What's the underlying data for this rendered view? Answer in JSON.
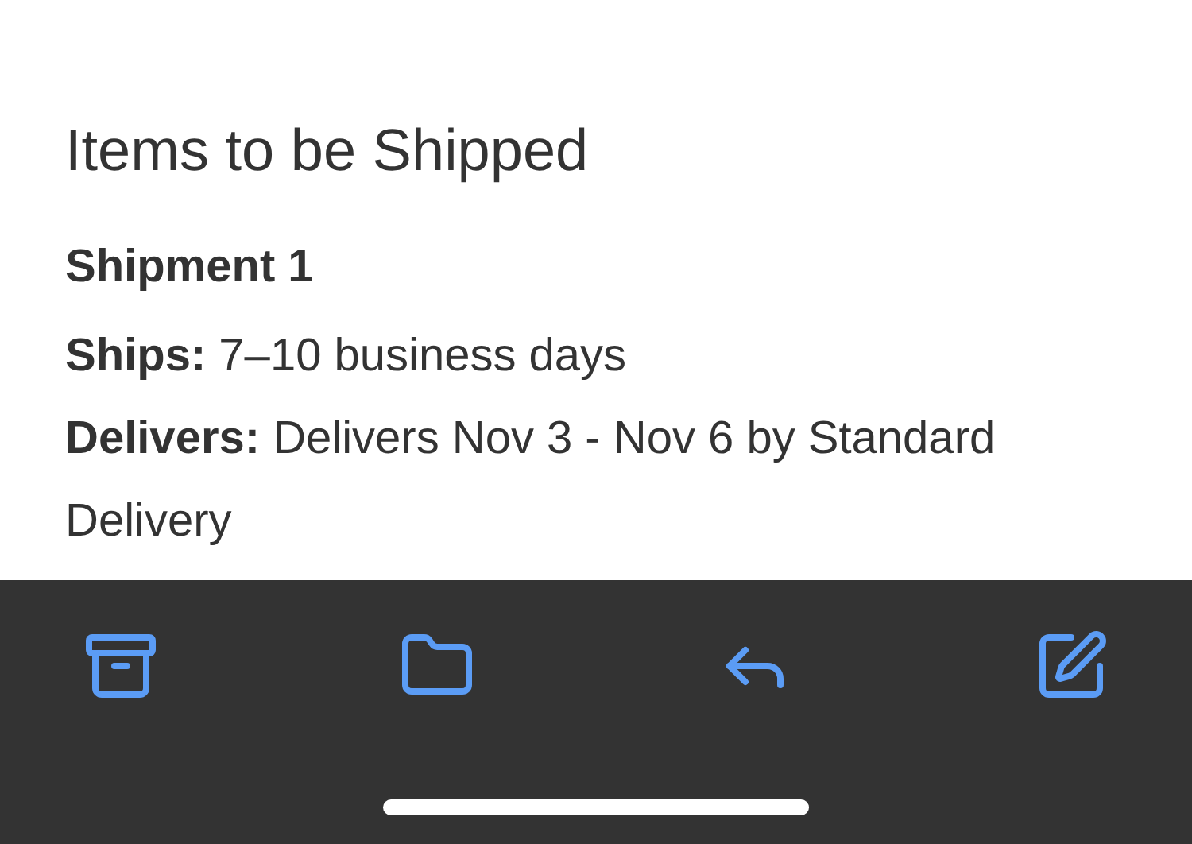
{
  "title": "Items to be Shipped",
  "shipment": {
    "heading": "Shipment 1",
    "lines": [
      "**Ships:** 7–10 business days",
      "**Delivers:** Delivers Nov 3 - Nov 6 by Standard Delivery"
    ]
  },
  "toolbar": [
    {
      "kind": "archive"
    },
    {
      "kind": "folder"
    },
    {
      "kind": "reply"
    },
    {
      "kind": "compose"
    }
  ]
}
